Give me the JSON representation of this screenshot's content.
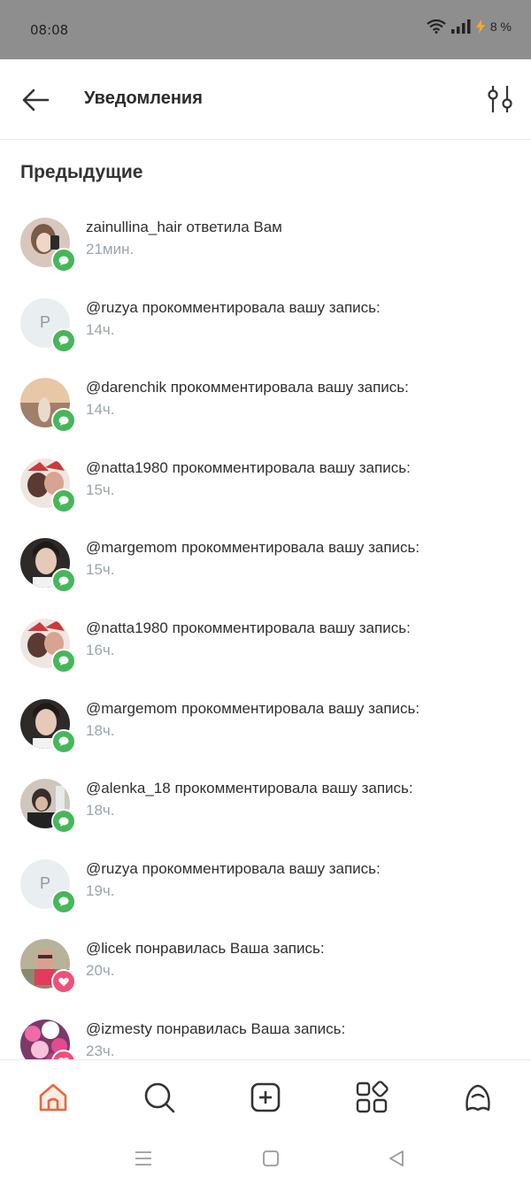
{
  "status_bar": {
    "time": "08:08",
    "battery": "8 %"
  },
  "header": {
    "title": "Уведомления"
  },
  "section_title": "Предыдущие",
  "notifications": [
    {
      "avatar": "photo",
      "type": "comment",
      "text": "zainullina_hair ответила Вам",
      "time": "21мин."
    },
    {
      "avatar_letter": "Р",
      "type": "comment",
      "text": "@ruzya прокомментировала вашу запись:",
      "time": "14ч."
    },
    {
      "avatar": "photo",
      "type": "comment",
      "text": "@darenchik прокомментировала вашу запись:",
      "time": "14ч."
    },
    {
      "avatar": "photo",
      "type": "comment",
      "text": "@natta1980 прокомментировала вашу запись:",
      "time": "15ч."
    },
    {
      "avatar": "photo",
      "type": "comment",
      "text": "@margemom прокомментировала вашу запись:",
      "time": "15ч."
    },
    {
      "avatar": "photo",
      "type": "comment",
      "text": "@natta1980 прокомментировала вашу запись:",
      "time": "16ч."
    },
    {
      "avatar": "photo",
      "type": "comment",
      "text": "@margemom прокомментировала вашу запись:",
      "time": "18ч."
    },
    {
      "avatar": "photo",
      "type": "comment",
      "text": "@alenka_18 прокомментировала вашу запись:",
      "time": "18ч."
    },
    {
      "avatar_letter": "Р",
      "type": "comment",
      "text": "@ruzya прокомментировала вашу запись:",
      "time": "19ч."
    },
    {
      "avatar": "photo",
      "type": "like",
      "text": "@licek понравилась Ваша запись:",
      "time": "20ч."
    },
    {
      "avatar": "photo",
      "type": "like",
      "text": "@izmesty понравилась Ваша запись:",
      "time": "23ч."
    }
  ],
  "bottom_nav": [
    "home-icon",
    "search-icon",
    "add-post-icon",
    "catalog-icon",
    "profile-icon"
  ],
  "colors": {
    "accent": "#e8673c",
    "comment_badge": "#46b75a",
    "like_badge": "#f0507a",
    "muted_text": "#9aa5ad"
  }
}
